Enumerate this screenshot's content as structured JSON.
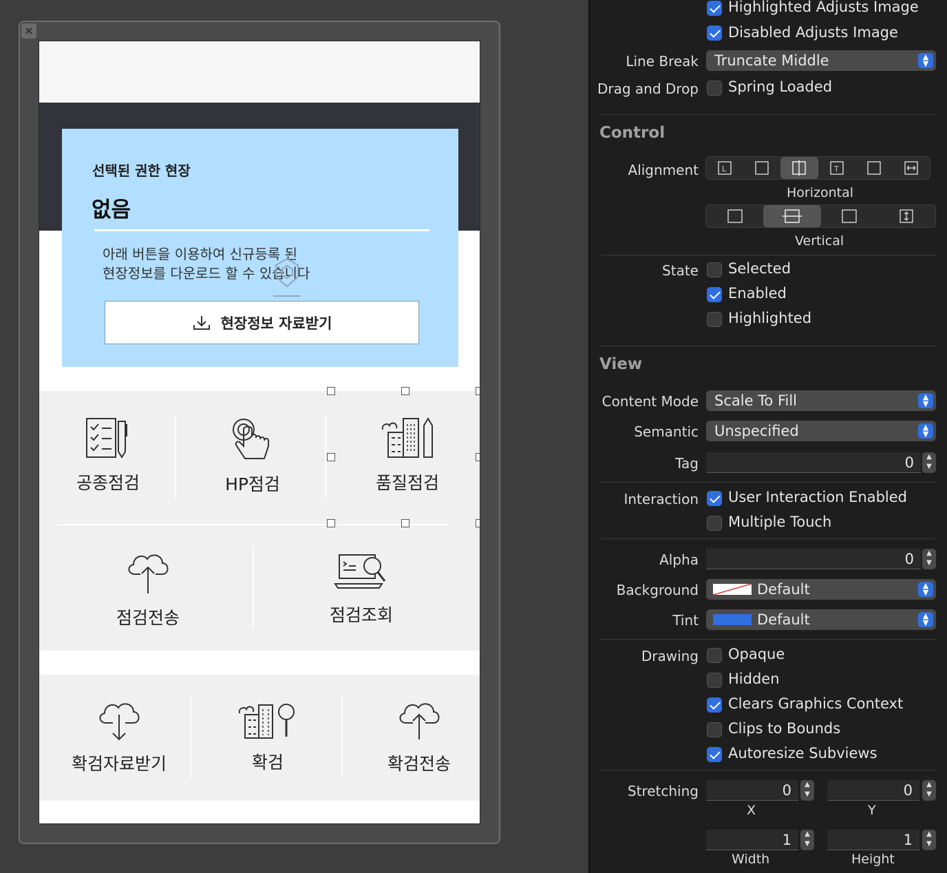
{
  "window": {
    "close_glyph": "×"
  },
  "app_screen": {
    "card": {
      "label": "선택된 권한 현장",
      "value": "없음",
      "description_line1": "아래 버튼을 이용하여 신규등록 된",
      "description_line2": "현장정보를 다운로드 할 수 있습니다",
      "download_button": "현장정보 자료받기"
    },
    "grid1": {
      "row1": [
        {
          "label": "공종점검",
          "icon": "checklist-pencil-icon"
        },
        {
          "label": "HP점검",
          "icon": "hand-pointer-icon"
        },
        {
          "label": "품질점검",
          "icon": "building-pen-icon"
        }
      ],
      "row2": [
        {
          "label": "점검전송",
          "icon": "cloud-upload-icon"
        },
        {
          "label": "점검조회",
          "icon": "laptop-search-icon"
        }
      ]
    },
    "grid2": [
      {
        "label": "확검자료받기",
        "icon": "cloud-download-icon"
      },
      {
        "label": "확검",
        "icon": "building-search-icon"
      },
      {
        "label": "확검전송",
        "icon": "cloud-upload-icon"
      }
    ]
  },
  "inspector": {
    "top_checks": [
      {
        "label": "Highlighted Adjusts Image",
        "checked": true
      },
      {
        "label": "Disabled Adjusts Image",
        "checked": true
      }
    ],
    "line_break": {
      "label": "Line Break",
      "value": "Truncate Middle"
    },
    "drag_drop": {
      "label": "Drag and Drop",
      "option": "Spring Loaded",
      "checked": false
    },
    "control": {
      "title": "Control",
      "alignment_label": "Alignment",
      "horizontal_label": "Horizontal",
      "vertical_label": "Vertical",
      "horizontal_selected_index": 2,
      "vertical_selected_index": 1,
      "state_label": "State",
      "states": [
        {
          "label": "Selected",
          "checked": false
        },
        {
          "label": "Enabled",
          "checked": true
        },
        {
          "label": "Highlighted",
          "checked": false
        }
      ]
    },
    "view": {
      "title": "View",
      "content_mode": {
        "label": "Content Mode",
        "value": "Scale To Fill"
      },
      "semantic": {
        "label": "Semantic",
        "value": "Unspecified"
      },
      "tag": {
        "label": "Tag",
        "value": "0"
      },
      "interaction_label": "Interaction",
      "interaction": [
        {
          "label": "User Interaction Enabled",
          "checked": true
        },
        {
          "label": "Multiple Touch",
          "checked": false
        }
      ],
      "alpha": {
        "label": "Alpha",
        "value": "0"
      },
      "background": {
        "label": "Background",
        "value": "Default"
      },
      "tint": {
        "label": "Tint",
        "value": "Default",
        "color": "#2f6fe0"
      },
      "drawing_label": "Drawing",
      "drawing": [
        {
          "label": "Opaque",
          "checked": false
        },
        {
          "label": "Hidden",
          "checked": false
        },
        {
          "label": "Clears Graphics Context",
          "checked": true
        },
        {
          "label": "Clips to Bounds",
          "checked": false
        },
        {
          "label": "Autoresize Subviews",
          "checked": true
        }
      ],
      "stretching": {
        "label": "Stretching",
        "x": "0",
        "y": "0",
        "width": "1",
        "height": "1",
        "x_label": "X",
        "y_label": "Y",
        "width_label": "Width",
        "height_label": "Height"
      }
    }
  }
}
